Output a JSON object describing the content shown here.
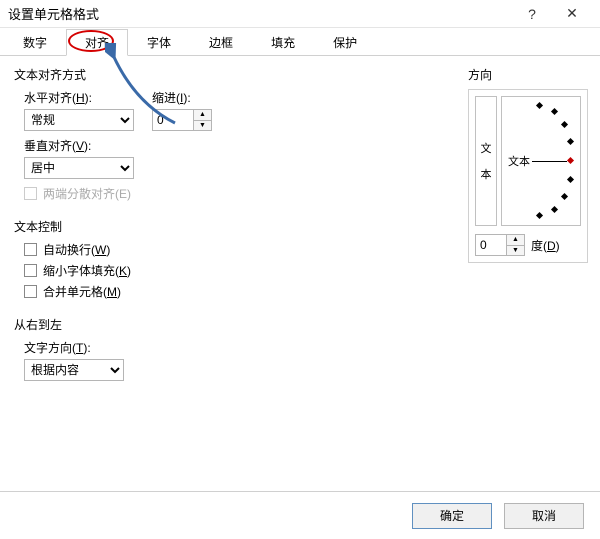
{
  "window": {
    "title": "设置单元格格式"
  },
  "tabs": [
    "数字",
    "对齐",
    "字体",
    "边框",
    "填充",
    "保护"
  ],
  "active_tab_index": 1,
  "sections": {
    "text_alignment": {
      "title": "文本对齐方式",
      "horizontal": {
        "label_pre": "水平对齐(",
        "key": "H",
        "label_post": "):",
        "value": "常规"
      },
      "vertical": {
        "label_pre": "垂直对齐(",
        "key": "V",
        "label_post": "):",
        "value": "居中"
      },
      "indent": {
        "label_pre": "缩进(",
        "key": "I",
        "label_post": "):",
        "value": "0"
      },
      "justify": {
        "label": "两端分散对齐(E)",
        "checked": false,
        "enabled": false
      }
    },
    "text_control": {
      "title": "文本控制",
      "wrap": {
        "label_pre": "自动换行(",
        "key": "W",
        "label_post": ")",
        "checked": false
      },
      "shrink": {
        "label_pre": "缩小字体填充(",
        "key": "K",
        "label_post": ")",
        "checked": false
      },
      "merge": {
        "label_pre": "合并单元格(",
        "key": "M",
        "label_post": ")",
        "checked": false
      }
    },
    "rtl": {
      "title": "从右到左",
      "direction": {
        "label_pre": "文字方向(",
        "key": "T",
        "label_post": "):",
        "value": "根据内容"
      }
    },
    "orientation": {
      "title": "方向",
      "vtext": [
        "文",
        "本"
      ],
      "htext": "文本",
      "degrees": {
        "value": "0",
        "label_pre": "度(",
        "key": "D",
        "label_post": ")"
      }
    }
  },
  "footer": {
    "ok": "确定",
    "cancel": "取消"
  }
}
